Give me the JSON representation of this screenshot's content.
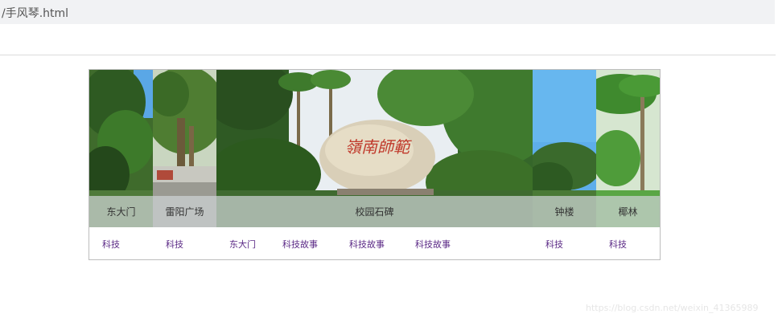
{
  "address_bar": {
    "text": "/手风琴.html"
  },
  "accordion": {
    "panels": [
      {
        "caption": "东大门",
        "links": [
          "科技"
        ]
      },
      {
        "caption": "雷阳广场",
        "links": [
          "科技"
        ]
      },
      {
        "caption": "校园石碑",
        "links": [
          "东大门",
          "科技故事",
          "科技故事",
          "科技故事"
        ],
        "stone_text": "嶺南師範"
      },
      {
        "caption": "钟楼",
        "links": [
          "科技"
        ]
      },
      {
        "caption": "椰林",
        "links": [
          "科技"
        ]
      }
    ]
  },
  "watermark": "https://blog.csdn.net/weixin_41365989",
  "colors": {
    "link": "#5b2a86",
    "caption_bg": "rgba(205,210,212,0.72)",
    "topbar_bg": "#f1f2f4"
  }
}
